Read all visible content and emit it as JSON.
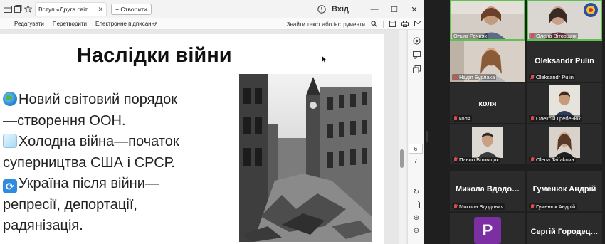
{
  "browser": {
    "tab_title": "Вступ «Друга світ…",
    "new_tab_label": "+ Створити",
    "sign_in_label": "Вхід"
  },
  "pdf_toolbar": {
    "menu": [
      "Редагувати",
      "Перетворити",
      "Електронне підписання"
    ],
    "find_placeholder": "Знайти текст або інструменти"
  },
  "slide": {
    "title": "Наслідки війни",
    "bullets": [
      "Новий світовий порядок",
      "—створення ООН.",
      "Холодна війна—початок",
      "суперництва США і СРСР.",
      "Україна після війни—",
      "репресії, депортації,",
      "радянізація."
    ]
  },
  "pager": {
    "page_a": "6",
    "page_b": "7"
  },
  "participants": [
    {
      "name": "Ольга Рочняк",
      "type": "video",
      "muted": false,
      "active": true
    },
    {
      "name": "Олена Вітовщик",
      "type": "video",
      "muted": true,
      "active": true
    },
    {
      "name": "Надія Бурлака",
      "type": "video",
      "muted": true,
      "active": false
    },
    {
      "name": "Oleksandr Pulin",
      "display": "Oleksandr Pulin",
      "type": "name",
      "muted": true
    },
    {
      "name": "коля",
      "display": "коля",
      "type": "name",
      "muted": true
    },
    {
      "name": "Олексій Гребенюк",
      "type": "thumb",
      "muted": true
    },
    {
      "name": "Павло Вітовщик",
      "type": "thumb",
      "muted": true
    },
    {
      "name": "Olena Taifakova",
      "type": "thumb",
      "muted": true
    },
    {
      "name": "Микола Вдодович",
      "display": "Микола  Вдодо…",
      "type": "name",
      "muted": true
    },
    {
      "name": "Гуменюк Андрій",
      "display": "Гуменюк Андрій",
      "type": "name",
      "muted": true
    },
    {
      "name": "P",
      "type": "avatar",
      "muted": false
    },
    {
      "name": "Сергій Городецький",
      "display": "Сергій Городец…",
      "type": "name",
      "muted": false
    }
  ],
  "colors": {
    "active_speaker": "#5ec24e",
    "muted": "#e24a4a",
    "avatar_purple": "#7b2fa3"
  }
}
